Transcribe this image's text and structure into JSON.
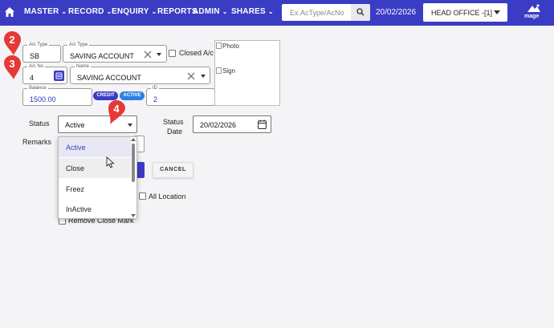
{
  "navbar": {
    "menus": [
      {
        "label": "MASTER",
        "has_chevron": true
      },
      {
        "label": "RECORD",
        "has_chevron": true
      },
      {
        "label": "ENQUIRY",
        "has_chevron": true
      },
      {
        "label": "REPORTS",
        "has_chevron": false
      },
      {
        "label": "ADMIN",
        "has_chevron": true
      },
      {
        "label": "SHARES",
        "has_chevron": true
      }
    ],
    "search_placeholder": "Ex.AcType/AcNo",
    "date": "20/02/2026",
    "office": "HEAD OFFICE -[1]",
    "logo_text": "mage",
    "color": "#3a3cc4"
  },
  "form": {
    "actype_code": {
      "label": "A/c Type",
      "value": "SB"
    },
    "actype_name": {
      "label": "A/c Type",
      "value": "SAVING ACCOUNT"
    },
    "closed_ac_label": "Closed A/c",
    "acno": {
      "label": "A/c No",
      "value": "4"
    },
    "name": {
      "label": "Name",
      "value": "SAVING ACCOUNT"
    },
    "balance": {
      "label": "Balance",
      "value": "1500.00"
    },
    "badges": [
      {
        "label": "CREDIT",
        "color": "#3a3cc4"
      },
      {
        "label": "ACTIVE",
        "color": "#2f7fe0"
      }
    ],
    "id": {
      "label": "ID",
      "value": "2"
    },
    "photo_alt": "Photo",
    "sign_alt": "Sign",
    "status_label": "Status",
    "status_value": "Active",
    "status_date_label_1": "Status",
    "status_date_label_2": "Date",
    "status_date_value": "20/02/2026",
    "remarks_label": "Remarks",
    "all_location_label": "All Location",
    "remove_close_mark_label": "Remove Close Mark",
    "cancel_label": "CANCEL"
  },
  "dropdown": {
    "options": [
      "Active",
      "Close",
      "Freez",
      "InActive"
    ],
    "selected": "Active",
    "hovered": "Close"
  },
  "markers": [
    "2",
    "3",
    "4"
  ],
  "marker_color": "#e53935"
}
